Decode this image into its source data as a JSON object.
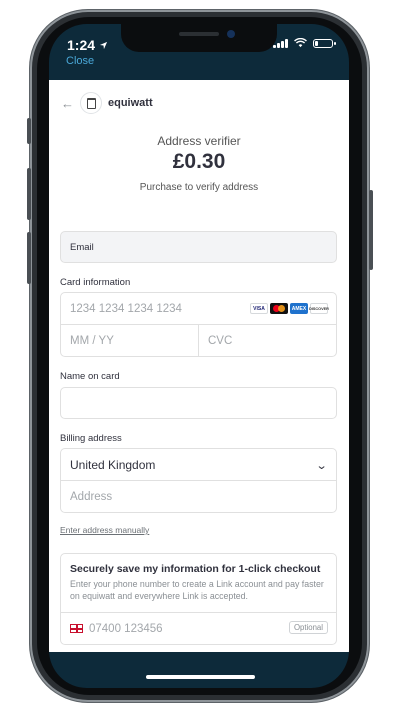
{
  "status_bar": {
    "time": "1:24"
  },
  "nav": {
    "close_label": "Close"
  },
  "merchant": {
    "name": "equiwatt"
  },
  "product": {
    "name": "Address verifier",
    "price": "£0.30",
    "description": "Purchase to verify address"
  },
  "email": {
    "placeholder": "Email"
  },
  "card": {
    "label": "Card information",
    "number_placeholder": "1234 1234 1234 1234",
    "expiry_placeholder": "MM / YY",
    "cvc_placeholder": "CVC",
    "brands": [
      "VISA",
      "mastercard",
      "AMEX",
      "DISCOVER"
    ]
  },
  "name_on_card": {
    "label": "Name on card",
    "value": ""
  },
  "billing": {
    "label": "Billing address",
    "country": "United Kingdom",
    "address_placeholder": "Address",
    "manual_link": "Enter address manually"
  },
  "link": {
    "title": "Securely save my information for 1-click checkout",
    "description": "Enter your phone number to create a Link account and pay faster on equiwatt and everywhere Link is accepted.",
    "phone_placeholder": "07400 123456",
    "optional_label": "Optional"
  },
  "colors": {
    "accent": "#4aa8d8",
    "header_bg": "#0d2a3a",
    "text": "#30313d"
  }
}
